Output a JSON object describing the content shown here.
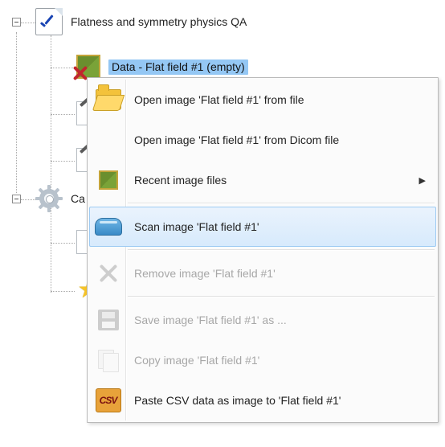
{
  "tree": {
    "root": {
      "label": "Flatness and symmetry physics QA",
      "expanded": true,
      "children": [
        {
          "label": "Data - Flat field #1 (empty)",
          "selected": true,
          "status": "empty"
        }
      ]
    },
    "calc": {
      "label_visible": "Ca",
      "expanded": true
    }
  },
  "menu": {
    "hovered_index": 3,
    "items": [
      {
        "label": "Open image 'Flat field #1' from file",
        "enabled": true,
        "submenu": false
      },
      {
        "label": "Open image 'Flat field #1' from Dicom file",
        "enabled": true,
        "submenu": false
      },
      {
        "label": "Recent image files",
        "enabled": true,
        "submenu": true
      },
      {
        "label": "Scan image 'Flat field #1'",
        "enabled": true,
        "submenu": false
      },
      {
        "label": "Remove image 'Flat field #1'",
        "enabled": false,
        "submenu": false
      },
      {
        "label": "Save image 'Flat field #1' as ...",
        "enabled": false,
        "submenu": false
      },
      {
        "label": "Copy image 'Flat field #1'",
        "enabled": false,
        "submenu": false
      },
      {
        "label": "Paste CSV data as image to 'Flat field #1'",
        "enabled": true,
        "submenu": false
      }
    ]
  },
  "colors": {
    "selection": "#94c7f4",
    "menu_hover_border": "#9ecbf3",
    "disabled_text": "#a7a7a7"
  }
}
